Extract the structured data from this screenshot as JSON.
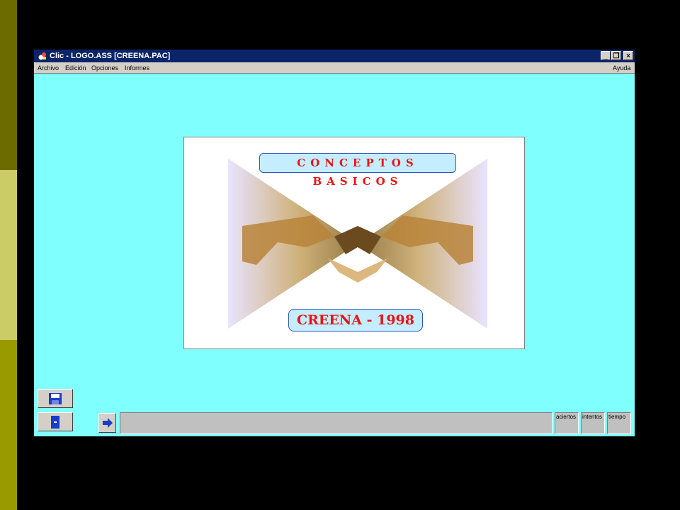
{
  "window": {
    "title": "Clic - LOGO.ASS [CREENA.PAC]",
    "minimize": "_",
    "restore": "❐",
    "close": "×"
  },
  "menu": {
    "items": [
      "Archivo",
      "Edición",
      "Opciones",
      "Informes"
    ],
    "help": "Ayuda"
  },
  "content": {
    "banner_top": "CONCEPTOS BASICOS",
    "banner_bottom": "CREENA - 1998"
  },
  "status": {
    "counters": [
      "aciertos",
      "intentos",
      "tiempo"
    ]
  },
  "colors": {
    "desktop": "#000000",
    "client": "#80ffff",
    "banner_text": "#ee1111",
    "titlebar": "#0a246a"
  },
  "icons": [
    "save-icon",
    "exit-door-icon",
    "next-arrow-icon"
  ]
}
